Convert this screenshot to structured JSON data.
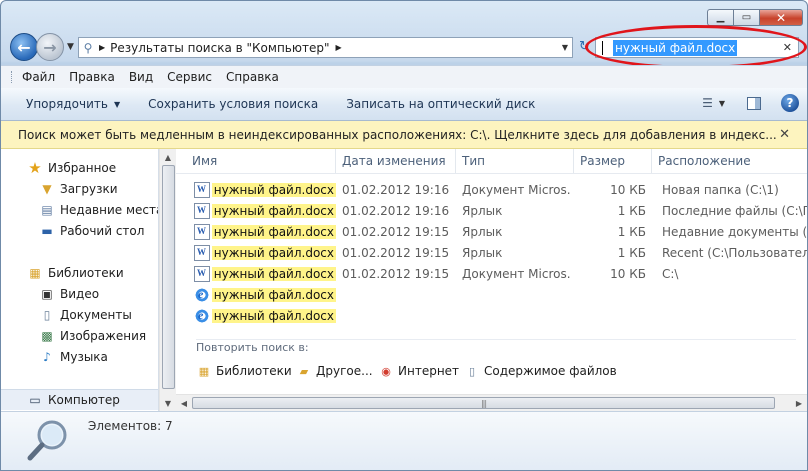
{
  "address": {
    "path": "Результаты поиска в \"Компьютер\""
  },
  "search": {
    "query": "нужный файл.docx"
  },
  "menu": [
    {
      "label": "Файл"
    },
    {
      "label": "Правка"
    },
    {
      "label": "Вид"
    },
    {
      "label": "Сервис"
    },
    {
      "label": "Справка"
    }
  ],
  "commands": {
    "organize": "Упорядочить",
    "save_search": "Сохранить условия поиска",
    "burn": "Записать на оптический диск"
  },
  "infobar": {
    "text": "Поиск может быть медленным в неиндексированных расположениях: C:\\. Щелкните здесь для добавления в индекс..."
  },
  "nav_pane": {
    "favorites": "Избранное",
    "downloads": "Загрузки",
    "recent": "Недавние места",
    "desktop": "Рабочий стол",
    "libraries": "Библиотеки",
    "video": "Видео",
    "documents": "Документы",
    "pictures": "Изображения",
    "music": "Музыка",
    "computer": "Компьютер"
  },
  "columns": {
    "name": "Имя",
    "date": "Дата изменения",
    "type": "Тип",
    "size": "Размер",
    "location": "Расположение"
  },
  "files": [
    {
      "icon": "word-doc-icon",
      "name": "нужный файл.docx",
      "date": "01.02.2012 19:16",
      "type": "Документ Micros...",
      "size": "10 КБ",
      "location": "Новая папка (C:\\1)"
    },
    {
      "icon": "word-shortcut-icon",
      "name": "нужный файл.docx",
      "date": "01.02.2012 19:16",
      "type": "Ярлык",
      "size": "1 КБ",
      "location": "Последние файлы (C:\\П..."
    },
    {
      "icon": "word-shortcut-icon",
      "name": "нужный файл.docx",
      "date": "01.02.2012 19:15",
      "type": "Ярлык",
      "size": "1 КБ",
      "location": "Недавние документы (C:\\..."
    },
    {
      "icon": "word-shortcut-icon",
      "name": "нужный файл.docx",
      "date": "01.02.2012 19:15",
      "type": "Ярлык",
      "size": "1 КБ",
      "location": "Recent (C:\\Пользовател..."
    },
    {
      "icon": "word-doc-icon",
      "name": "нужный файл.docx",
      "date": "01.02.2012 19:15",
      "type": "Документ Micros...",
      "size": "10 КБ",
      "location": "C:\\"
    },
    {
      "icon": "ie-link-icon",
      "name": "нужный файл.docx",
      "date": "",
      "type": "",
      "size": "",
      "location": ""
    },
    {
      "icon": "ie-link-icon",
      "name": "нужный файл.docx",
      "date": "",
      "type": "",
      "size": "",
      "location": ""
    }
  ],
  "repeat_search": {
    "label": "Повторить поиск в:",
    "libraries": "Библиотеки",
    "other": "Другое...",
    "internet": "Интернет",
    "file_contents": "Содержимое файлов"
  },
  "status": {
    "items": "Элементов: 7"
  }
}
